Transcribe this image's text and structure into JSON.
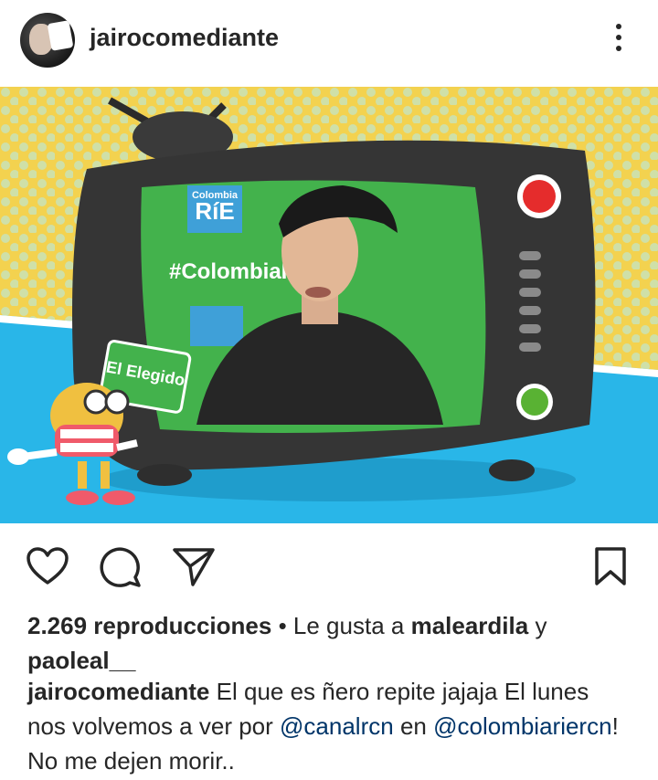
{
  "post": {
    "username": "jairocomediante",
    "media": {
      "overlay_top": "Colombia",
      "overlay_brand": "RíE",
      "hashtag": "#ColombiaR",
      "badge": "El Elegido"
    },
    "stats": {
      "views": "2.269 reproducciones",
      "liked_by_prefix": "• Le gusta a",
      "liked_by_1": "maleardila",
      "liked_by_join": "y",
      "liked_by_2": "paoleal__"
    },
    "caption": {
      "author": "jairocomediante",
      "text_1": "El que es ñero repite jajaja El lunes nos volvemos a ver por",
      "mention_1": "@canalrcn",
      "text_2": "en",
      "mention_2": "@colombiariercn",
      "text_3": "! No me dejen morir.."
    }
  },
  "icons": {
    "like": "heart-icon",
    "comment": "comment-icon",
    "share": "send-icon",
    "save": "bookmark-icon",
    "more": "more-vertical-icon"
  },
  "colors": {
    "text": "#262626",
    "mention": "#003569",
    "media_yellow": "#f3d24f",
    "media_blue": "#29b6e8",
    "green_screen": "#43b24c"
  }
}
